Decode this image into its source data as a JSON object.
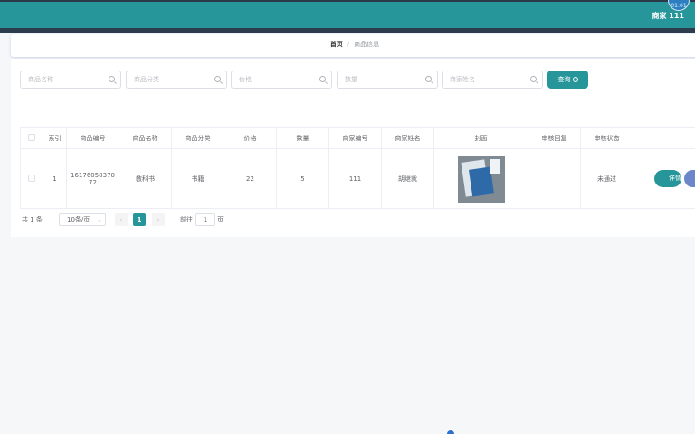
{
  "header": {
    "user_label": "商家 111",
    "avatar_text": "01:01"
  },
  "breadcrumb": {
    "home": "首页",
    "separator": "/",
    "current": "商品信息"
  },
  "search": {
    "name_placeholder": "商品名称",
    "category_placeholder": "商品分类",
    "price_placeholder": "价格",
    "quantity_placeholder": "数量",
    "merchant_placeholder": "商家姓名",
    "query_label": "查询"
  },
  "table": {
    "headers": [
      "索引",
      "商品编号",
      "商品名称",
      "商品分类",
      "价格",
      "数量",
      "商家编号",
      "商家姓名",
      "封面",
      "审核回复",
      "审核状态"
    ],
    "rows": [
      {
        "index": "1",
        "product_no_l1": "16176058370",
        "product_no_l2": "72",
        "name": "教科书",
        "category": "书籍",
        "price": "22",
        "quantity": "5",
        "merchant_no": "111",
        "merchant_name": "胡继就",
        "reply": "",
        "status": "未通过",
        "detail_label": "详情"
      }
    ]
  },
  "pagination": {
    "total": "共 1 条",
    "page_size": "10条/页",
    "prev": "‹",
    "current": "1",
    "next": "›",
    "goto_label": "前往",
    "goto_value": "1",
    "goto_suffix": "页"
  },
  "colors": {
    "brand": "#27969a",
    "nav_dark": "#2e3d4d"
  }
}
